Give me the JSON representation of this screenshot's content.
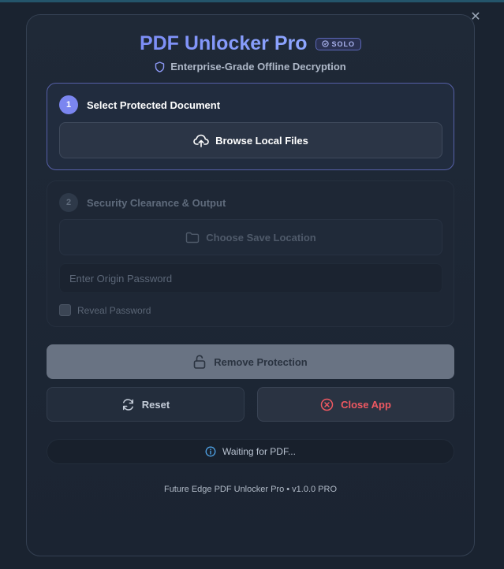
{
  "window": {
    "minimize_glyph": "–",
    "close_glyph": "✕"
  },
  "header": {
    "title": "PDF Unlocker Pro",
    "badge": "SOLO",
    "subtitle": "Enterprise-Grade Offline Decryption",
    "subtitle_icon": "shield-icon"
  },
  "step1": {
    "number": "1",
    "title": "Select Protected Document",
    "browse_label": "Browse Local Files",
    "browse_icon": "cloud-upload-icon"
  },
  "step2": {
    "number": "2",
    "title": "Security Clearance & Output",
    "save_label": "Choose Save Location",
    "save_icon": "folder-icon",
    "password_placeholder": "Enter Origin Password",
    "password_value": "",
    "reveal_label": "Reveal Password",
    "reveal_checked": false
  },
  "actions": {
    "remove_label": "Remove Protection",
    "remove_icon": "unlock-icon",
    "reset_label": "Reset",
    "reset_icon": "refresh-icon",
    "close_label": "Close App",
    "close_icon": "close-circle-icon"
  },
  "status": {
    "text": "Waiting for PDF...",
    "icon": "info-icon"
  },
  "footer": {
    "text": "Future Edge PDF Unlocker Pro • v1.0.0 PRO"
  },
  "colors": {
    "accent": "#7b86f0",
    "danger": "#ee5861",
    "background": "#1a2330"
  }
}
